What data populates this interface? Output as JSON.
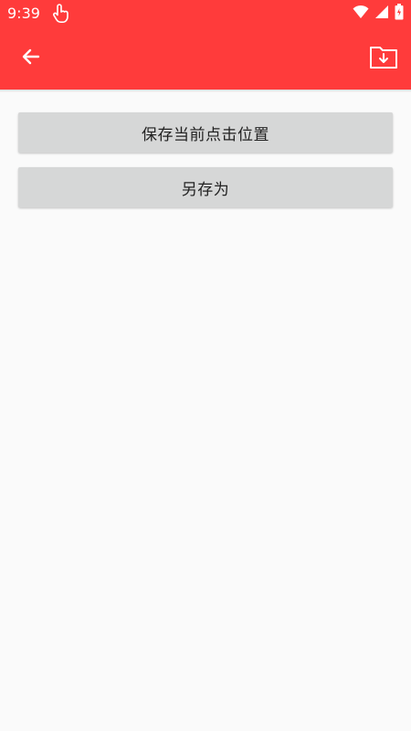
{
  "status_bar": {
    "time": "9:39",
    "icons": [
      "touch-hand-icon",
      "wifi-icon",
      "signal-icon",
      "battery-icon"
    ],
    "background": "#ff3b3b"
  },
  "app_bar": {
    "background": "#ff3b3b",
    "back_icon": "arrow-left-icon",
    "action_icon": "folder-download-icon"
  },
  "actions": {
    "save_current_position_label": "保存当前点击位置",
    "save_as_label": "另存为"
  }
}
